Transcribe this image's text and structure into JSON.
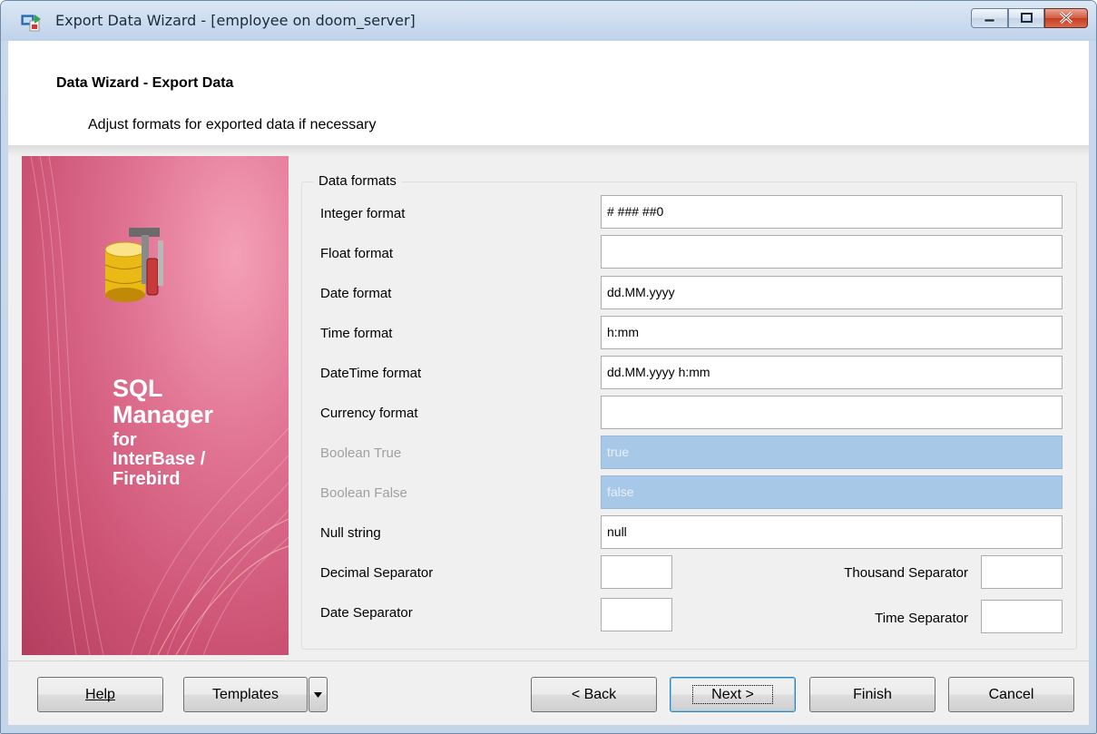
{
  "window": {
    "title": "Export Data Wizard - [employee on doom_server]"
  },
  "header": {
    "title": "Data Wizard - Export Data",
    "subtitle": "Adjust formats for exported data if necessary"
  },
  "sidebar": {
    "line1": "SQL",
    "line2": "Manager",
    "line3": "for",
    "line4": "InterBase /",
    "line5": "Firebird"
  },
  "formats": {
    "group_label": "Data formats",
    "integer": {
      "label": "Integer format",
      "value": "# ### ##0"
    },
    "float": {
      "label": "Float format",
      "value": ""
    },
    "date": {
      "label": "Date format",
      "value": "dd.MM.yyyy"
    },
    "time": {
      "label": "Time format",
      "value": "h:mm"
    },
    "datetime": {
      "label": "DateTime format",
      "value": "dd.MM.yyyy h:mm"
    },
    "currency": {
      "label": "Currency format",
      "value": ""
    },
    "bool_true": {
      "label": "Boolean True",
      "value": "true"
    },
    "bool_false": {
      "label": "Boolean False",
      "value": "false"
    },
    "null_string": {
      "label": "Null string",
      "value": "null"
    },
    "decimal_sep": {
      "label": "Decimal Separator",
      "value": ""
    },
    "thousand_sep": {
      "label": "Thousand Separator",
      "value": ""
    },
    "date_sep": {
      "label": "Date Separator",
      "value": ""
    },
    "time_sep": {
      "label": "Time Separator",
      "value": ""
    }
  },
  "buttons": {
    "help": "Help",
    "templates": "Templates",
    "back": "< Back",
    "next": "Next >",
    "finish": "Finish",
    "cancel": "Cancel"
  },
  "colors": {
    "disabled_field": "#a8c8e8",
    "sidebar_pink": "#d45a7c"
  },
  "icons": [
    "app-icon",
    "minimize-icon",
    "maximize-icon",
    "close-icon",
    "database-tools-icon",
    "dropdown-arrow-icon"
  ]
}
